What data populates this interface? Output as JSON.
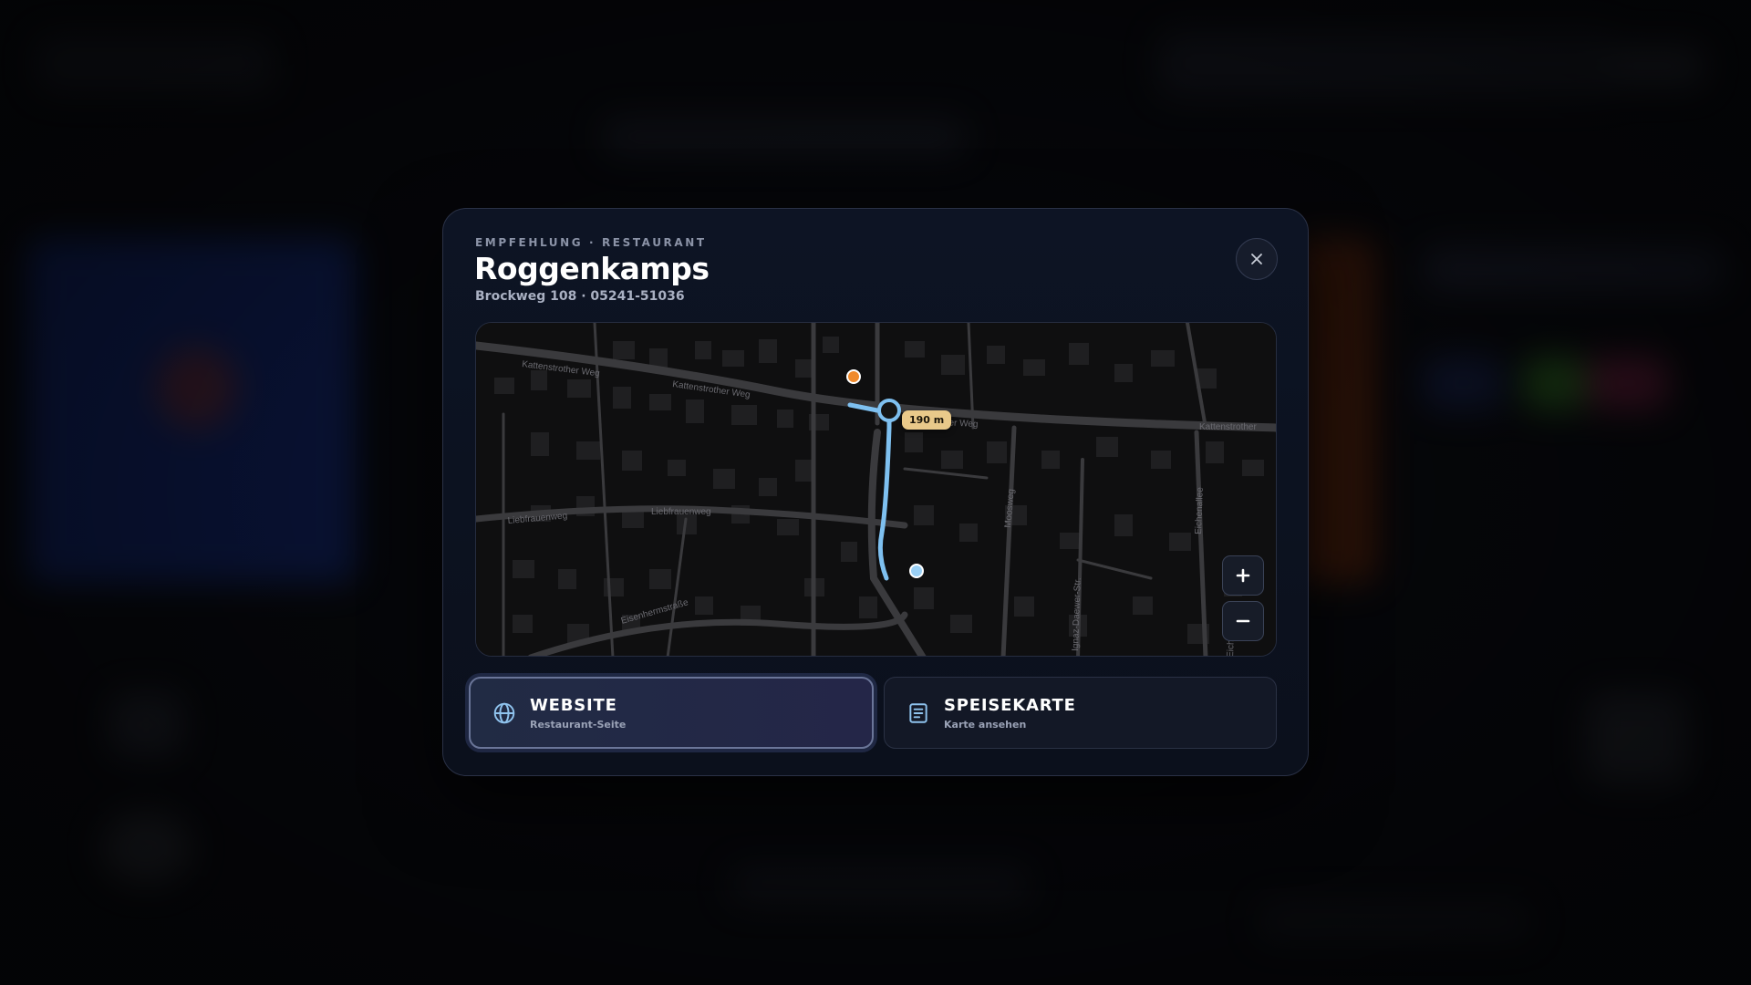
{
  "modal": {
    "eyebrow": "EMPFEHLUNG · RESTAURANT",
    "title": "Roggenkamps",
    "subtitle": "Brockweg 108 · 05241-51036"
  },
  "map": {
    "distance_label": "190 m",
    "street_labels": [
      "Kattenstrother Weg",
      "Kattenstrother Weg",
      "ther Weg",
      "Kattenstrother",
      "Liebfrauenweg",
      "Liebfrauenweg",
      "Moosweg",
      "Eichenallee",
      "Eisenhermstraße",
      "Ignaz-Daewer-Str.",
      "Eich"
    ],
    "zoom_in_label": "+",
    "zoom_out_label": "−",
    "colors": {
      "route": "#7ec0f0",
      "restaurant_marker": "#f08a2c",
      "user_marker": "#9ad0f5"
    }
  },
  "actions": {
    "website": {
      "label": "WEBSITE",
      "sublabel": "Restaurant-Seite",
      "icon": "globe-icon"
    },
    "menu": {
      "label": "SPEISEKARTE",
      "sublabel": "Karte ansehen",
      "icon": "document-icon"
    }
  },
  "close_icon": "close-icon"
}
